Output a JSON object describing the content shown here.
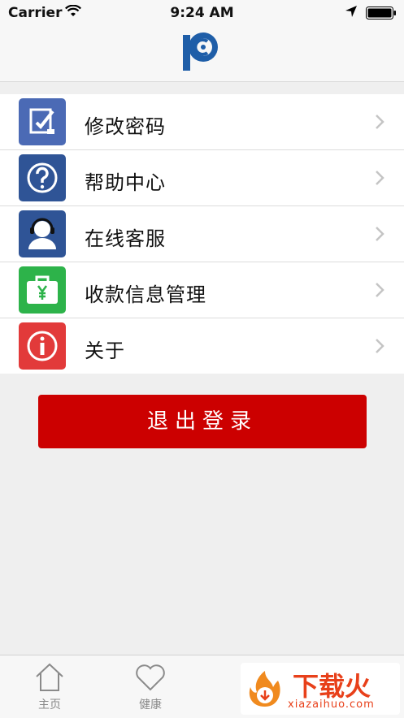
{
  "status_bar": {
    "carrier": "Carrier",
    "time": "9:24 AM"
  },
  "menu": {
    "items": [
      {
        "label": "修改密码",
        "icon": "edit-password-icon",
        "color": "#4b6ab5"
      },
      {
        "label": "帮助中心",
        "icon": "help-icon",
        "color": "#2f5496"
      },
      {
        "label": "在线客服",
        "icon": "customer-service-icon",
        "color": "#2f5496"
      },
      {
        "label": "收款信息管理",
        "icon": "wallet-icon",
        "color": "#2db34a"
      },
      {
        "label": "关于",
        "icon": "info-icon",
        "color": "#e23a3a"
      }
    ]
  },
  "logout": {
    "label": "退出登录",
    "color": "#cc0000"
  },
  "tab_bar": {
    "tabs": [
      {
        "label": "主页",
        "icon": "home-icon"
      },
      {
        "label": "健康",
        "icon": "heart-icon"
      }
    ]
  },
  "watermark": {
    "title": "下载火",
    "subtitle": "xiazaihuo.com"
  }
}
